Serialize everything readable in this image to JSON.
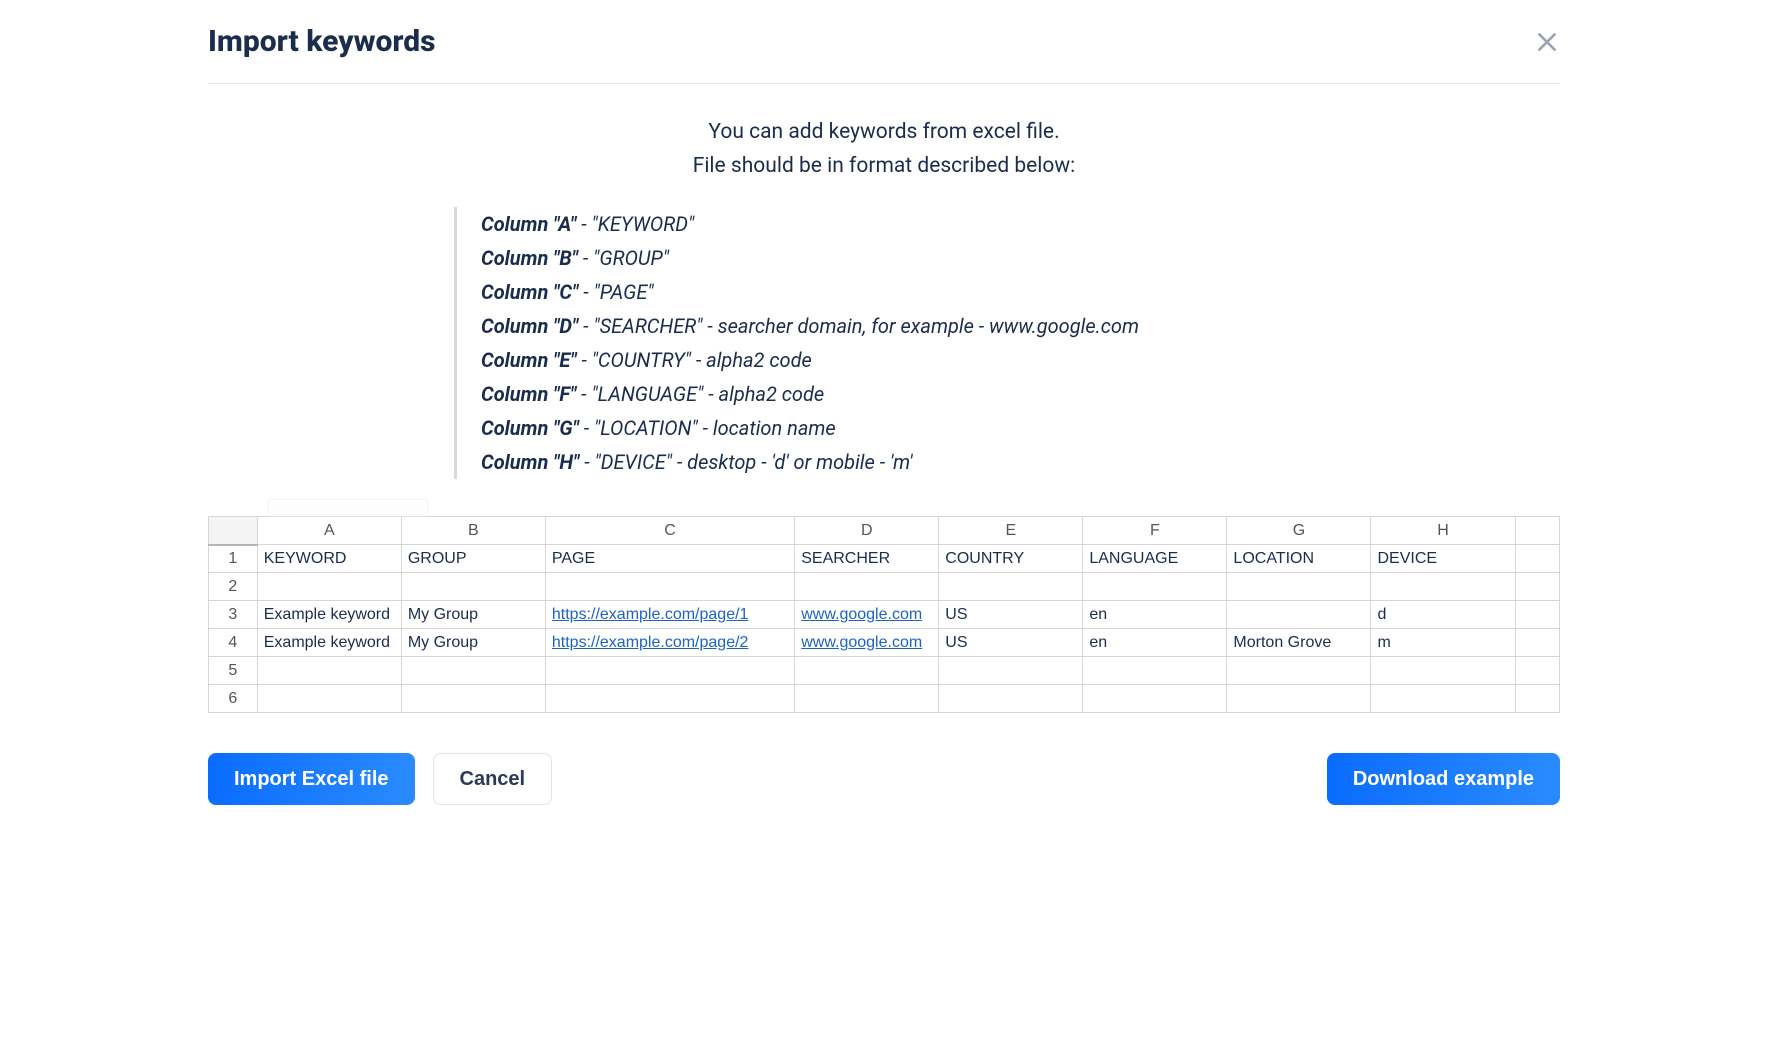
{
  "title": "Import keywords",
  "info": {
    "line1": "You can add keywords from excel file.",
    "line2": "File should be in format described below:"
  },
  "columns": [
    {
      "label": "Column \"A\"",
      "desc": " - \"KEYWORD\""
    },
    {
      "label": "Column \"B\"",
      "desc": " - \"GROUP\""
    },
    {
      "label": "Column \"C\"",
      "desc": " - \"PAGE\""
    },
    {
      "label": "Column \"D\"",
      "desc": " - \"SEARCHER\" - searcher domain, for example - www.google.com"
    },
    {
      "label": "Column \"E\"",
      "desc": " - \"COUNTRY\" - alpha2 code"
    },
    {
      "label": "Column \"F\"",
      "desc": " - \"LANGUAGE\" - alpha2 code"
    },
    {
      "label": "Column \"G\"",
      "desc": " - \"LOCATION\" - location name"
    },
    {
      "label": "Column \"H\"",
      "desc": " - \"DEVICE\" - desktop - 'd' or mobile - 'm'"
    }
  ],
  "sheet": {
    "col_letters": [
      "A",
      "B",
      "C",
      "D",
      "E",
      "F",
      "G",
      "H"
    ],
    "header_row": [
      "KEYWORD",
      "GROUP",
      "PAGE",
      "SEARCHER",
      "COUNTRY",
      "LANGUAGE",
      "LOCATION",
      "DEVICE"
    ],
    "rows": [
      {
        "num": "1",
        "cells": [
          "KEYWORD",
          "GROUP",
          "PAGE",
          "SEARCHER",
          "COUNTRY",
          "LANGUAGE",
          "LOCATION",
          "DEVICE"
        ]
      },
      {
        "num": "2",
        "cells": [
          "",
          "",
          "",
          "",
          "",
          "",
          "",
          ""
        ]
      },
      {
        "num": "3",
        "cells": [
          "Example keyword",
          "My Group",
          "https://example.com/page/1",
          "www.google.com",
          "US",
          "en",
          "",
          "d"
        ],
        "links": [
          2,
          3
        ]
      },
      {
        "num": "4",
        "cells": [
          "Example keyword",
          "My Group",
          "https://example.com/page/2",
          "www.google.com",
          "US",
          "en",
          "Morton Grove",
          "m"
        ],
        "links": [
          2,
          3
        ]
      },
      {
        "num": "5",
        "cells": [
          "",
          "",
          "",
          "",
          "",
          "",
          "",
          ""
        ]
      },
      {
        "num": "6",
        "cells": [
          "",
          "",
          "",
          "",
          "",
          "",
          "",
          ""
        ]
      }
    ]
  },
  "buttons": {
    "import": "Import Excel file",
    "cancel": "Cancel",
    "download": "Download example"
  }
}
